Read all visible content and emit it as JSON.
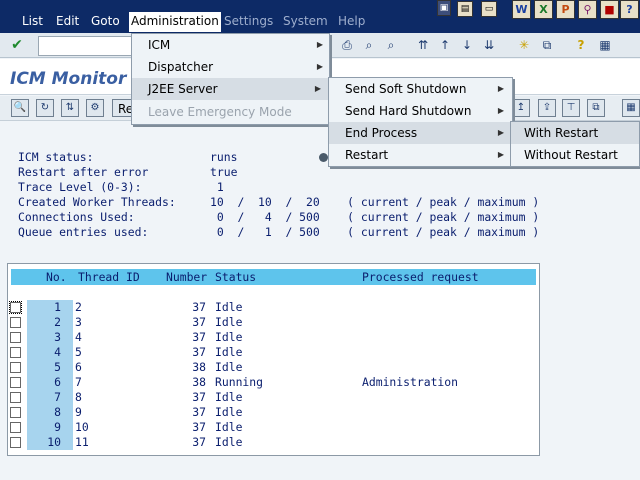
{
  "menubar": {
    "items": [
      "List",
      "Edit",
      "Goto",
      "Administration",
      "Settings",
      "System",
      "Help"
    ]
  },
  "title": "ICM Monitor",
  "appbar": {
    "refresh_label": "Re"
  },
  "status": {
    "lines": [
      "ICM status:                 runs",
      "Restart after error         true",
      "Trace Level (0-3):           1",
      "Created Worker Threads:     10  /  10  /  20    ( current / peak / maximum )",
      "Connections Used:            0  /   4  / 500    ( current / peak / maximum )",
      "Queue entries used:          0  /   1  / 500    ( current / peak / maximum )"
    ]
  },
  "table": {
    "headers": [
      "No.",
      "Thread ID",
      "Number",
      "Status",
      "Processed request"
    ],
    "rows": [
      {
        "no": "1",
        "thread": "2",
        "number": "37",
        "status": "Idle",
        "request": ""
      },
      {
        "no": "2",
        "thread": "3",
        "number": "37",
        "status": "Idle",
        "request": ""
      },
      {
        "no": "3",
        "thread": "4",
        "number": "37",
        "status": "Idle",
        "request": ""
      },
      {
        "no": "4",
        "thread": "5",
        "number": "37",
        "status": "Idle",
        "request": ""
      },
      {
        "no": "5",
        "thread": "6",
        "number": "38",
        "status": "Idle",
        "request": ""
      },
      {
        "no": "6",
        "thread": "7",
        "number": "38",
        "status": "Running",
        "request": "Administration"
      },
      {
        "no": "7",
        "thread": "8",
        "number": "37",
        "status": "Idle",
        "request": ""
      },
      {
        "no": "8",
        "thread": "9",
        "number": "37",
        "status": "Idle",
        "request": ""
      },
      {
        "no": "9",
        "thread": "10",
        "number": "37",
        "status": "Idle",
        "request": ""
      },
      {
        "no": "10",
        "thread": "11",
        "number": "37",
        "status": "Idle",
        "request": ""
      }
    ]
  },
  "menus": {
    "administration": [
      {
        "label": "ICM",
        "key": "I",
        "submenu": true,
        "enabled": true
      },
      {
        "label": "Dispatcher",
        "key": "D",
        "submenu": true,
        "enabled": true
      },
      {
        "label": "J2EE Server",
        "key": "J",
        "submenu": true,
        "enabled": true,
        "selected": true
      },
      {
        "label": "Leave Emergency Mode",
        "key": "g",
        "submenu": false,
        "enabled": false
      }
    ],
    "j2ee": [
      {
        "label": "Send Soft Shutdown",
        "key": "S",
        "submenu": true
      },
      {
        "label": "Send Hard Shutdown",
        "key": "H",
        "submenu": true
      },
      {
        "label": "End Process",
        "key": "P",
        "submenu": true,
        "selected": true
      },
      {
        "label": "Restart",
        "key": "R",
        "submenu": true
      }
    ],
    "endprocess": [
      {
        "label": "With Restart",
        "key": "W",
        "selected": true
      },
      {
        "label": "Without Restart",
        "key": "u"
      }
    ]
  },
  "colors": {
    "menubar": "#0d2a66",
    "title": "#3a5fa2",
    "header": "#5ec4ec",
    "rowno": "#a7d4ee",
    "text": "#0a1e6e"
  }
}
